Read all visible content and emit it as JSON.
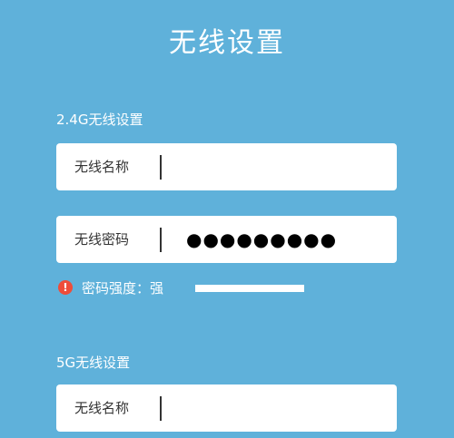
{
  "header": {
    "title": "无线设置"
  },
  "wifi_24g": {
    "section_title": "2.4G无线设置",
    "name_label": "无线名称",
    "name_value": "",
    "password_label": "无线密码",
    "password_mask": "●●●●●●●●●",
    "strength_label": "密码强度：",
    "strength_value": "强",
    "strength_level": 1.0,
    "warning_icon": "warning-icon"
  },
  "wifi_5g": {
    "section_title": "5G无线设置",
    "name_label": "无线名称",
    "name_value": ""
  },
  "colors": {
    "background": "#5fb1da",
    "field": "#ffffff",
    "warning": "#ee4d3a"
  }
}
